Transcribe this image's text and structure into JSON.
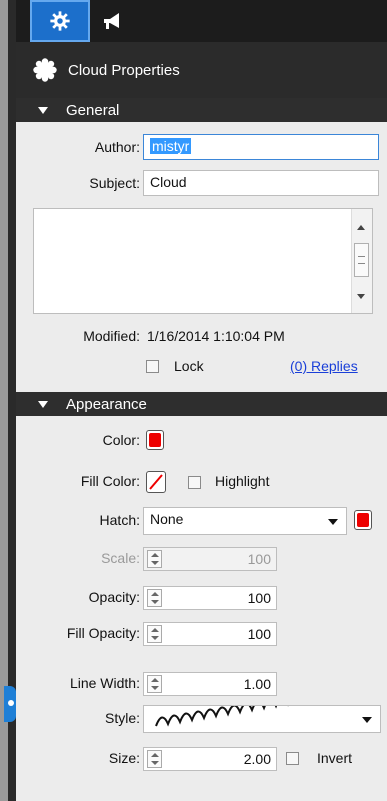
{
  "panel": {
    "title": "Cloud Properties",
    "tabs": [
      {
        "name": "properties",
        "icon": "gear-icon",
        "active": true
      },
      {
        "name": "markup",
        "icon": "megaphone-icon",
        "active": false
      }
    ]
  },
  "general": {
    "header": "General",
    "author_label": "Author:",
    "author_value": "mistyr",
    "subject_label": "Subject:",
    "subject_value": "Cloud",
    "comment_value": "",
    "modified_label": "Modified:",
    "modified_value": "1/16/2014 1:10:04 PM",
    "lock_label": "Lock",
    "lock_checked": false,
    "replies_link": "(0) Replies"
  },
  "appearance": {
    "header": "Appearance",
    "color_label": "Color:",
    "color_value": "#ee0000",
    "fill_color_label": "Fill Color:",
    "fill_color_value": "none",
    "highlight_label": "Highlight",
    "highlight_checked": false,
    "hatch_label": "Hatch:",
    "hatch_value": "None",
    "hatch_color": "#ee0000",
    "scale_label": "Scale:",
    "scale_value": "100",
    "opacity_label": "Opacity:",
    "opacity_value": "100",
    "fill_opacity_label": "Fill Opacity:",
    "fill_opacity_value": "100",
    "line_width_label": "Line Width:",
    "line_width_value": "1.00",
    "style_label": "Style:",
    "style_value": "cloud-loops",
    "size_label": "Size:",
    "size_value": "2.00",
    "invert_label": "Invert",
    "invert_checked": false
  }
}
